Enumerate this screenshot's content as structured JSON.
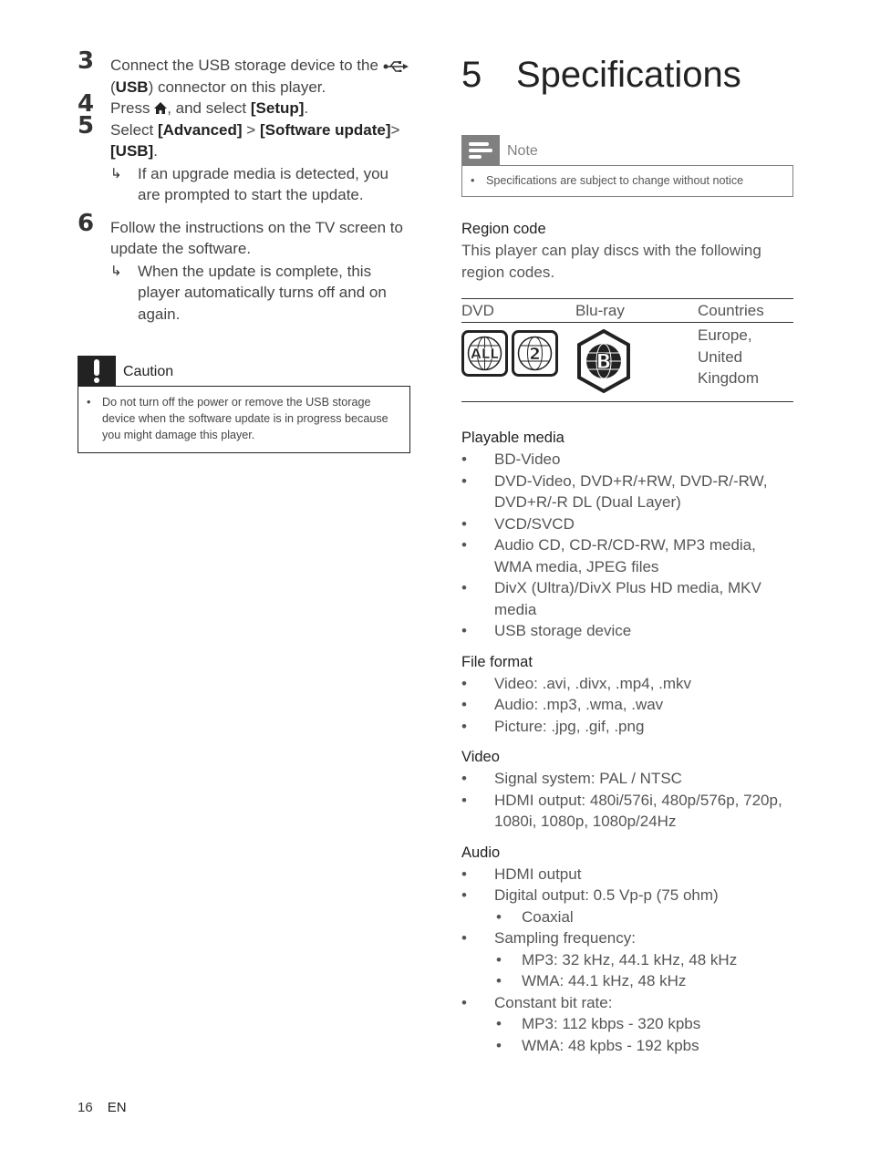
{
  "left_column": {
    "steps": [
      {
        "num": "3",
        "parts": [
          "Connect the USB storage device to the ",
          "icon:usb",
          " (",
          "b:USB",
          ") connector on this player."
        ]
      },
      {
        "num": "4",
        "parts": [
          "Press ",
          "icon:home",
          ", and select ",
          "b:[Setup]",
          "."
        ]
      },
      {
        "num": "5",
        "parts": [
          "Select ",
          "b:[Advanced]",
          " > ",
          "b:[Software update]",
          "> ",
          "b:[USB]",
          "."
        ],
        "result": "If an upgrade media is detected, you are prompted to start the update."
      },
      {
        "num": "6",
        "parts": [
          "Follow the instructions on the TV screen to update the software."
        ],
        "result": "When the update is complete, this player automatically turns off and on again."
      }
    ],
    "caution": {
      "title": "Caution",
      "text": "Do not turn off the power or remove the USB storage device when the software update is in progress because you might damage this player."
    }
  },
  "right_column": {
    "chapter_number": "5",
    "chapter_title": "Specifications",
    "note": {
      "title": "Note",
      "text": "Specifications are subject to change without notice"
    },
    "region_code": {
      "heading": "Region code",
      "description": "This player can play discs with the following region codes.",
      "table": {
        "headers": [
          "DVD",
          "Blu-ray",
          "Countries"
        ],
        "dvd_logos": [
          "ALL",
          "2"
        ],
        "bluray_logo": "B",
        "countries": "Europe, United Kingdom"
      }
    },
    "sections": [
      {
        "heading": "Playable media",
        "items": [
          {
            "text": "BD-Video"
          },
          {
            "text": "DVD-Video, DVD+R/+RW, DVD-R/-RW, DVD+R/-R DL (Dual Layer)"
          },
          {
            "text": "VCD/SVCD"
          },
          {
            "text": "Audio CD, CD-R/CD-RW, MP3 media, WMA media, JPEG files"
          },
          {
            "text": "DivX (Ultra)/DivX Plus HD media, MKV media"
          },
          {
            "text": "USB storage device"
          }
        ]
      },
      {
        "heading": "File format",
        "items": [
          {
            "text": "Video: .avi, .divx, .mp4, .mkv"
          },
          {
            "text": "Audio: .mp3, .wma, .wav"
          },
          {
            "text": "Picture: .jpg, .gif, .png"
          }
        ]
      },
      {
        "heading": "Video",
        "items": [
          {
            "text": "Signal system: PAL / NTSC"
          },
          {
            "text": "HDMI output: 480i/576i, 480p/576p, 720p, 1080i, 1080p, 1080p/24Hz"
          }
        ]
      },
      {
        "heading": "Audio",
        "items": [
          {
            "text": "HDMI output"
          },
          {
            "text": "Digital output: 0.5 Vp-p (75 ohm)"
          },
          {
            "text": "Coaxial",
            "sub": true
          },
          {
            "text": "Sampling frequency:"
          },
          {
            "text": "MP3: 32 kHz, 44.1 kHz, 48 kHz",
            "sub": true
          },
          {
            "text": "WMA: 44.1 kHz, 48 kHz",
            "sub": true
          },
          {
            "text": "Constant bit rate:"
          },
          {
            "text": "MP3: 112 kbps - 320 kpbs",
            "sub": true
          },
          {
            "text": "WMA: 48 kpbs - 192 kpbs",
            "sub": true
          }
        ]
      }
    ]
  },
  "footer": {
    "page_number": "16",
    "language": "EN"
  },
  "glyphs": {
    "bullet": "•",
    "result_arrow": "↳"
  }
}
